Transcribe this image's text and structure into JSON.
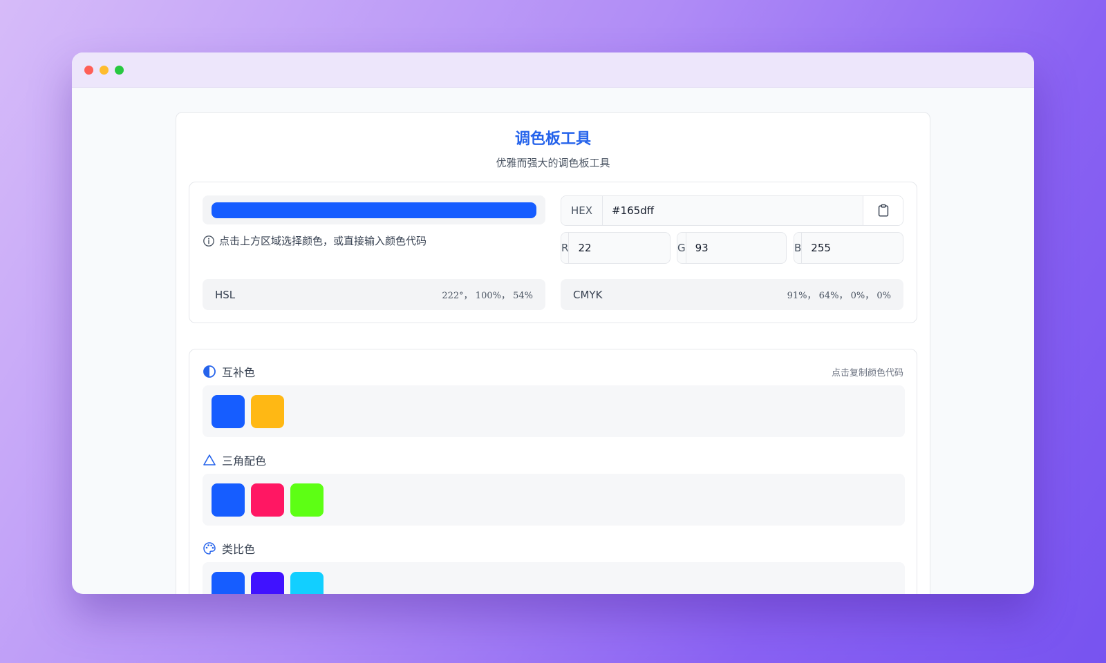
{
  "app": {
    "title": "调色板工具",
    "subtitle": "优雅而强大的调色板工具"
  },
  "picker": {
    "selected_color": "#165dff",
    "hint": "点击上方区域选择颜色，或直接输入颜色代码",
    "hex": {
      "label": "HEX",
      "value": "#165dff",
      "copy_icon": "clipboard-icon"
    },
    "rgb": [
      {
        "label": "R",
        "value": "22"
      },
      {
        "label": "G",
        "value": "93"
      },
      {
        "label": "B",
        "value": "255"
      }
    ],
    "hsl": {
      "label": "HSL",
      "value": "222°， 100%， 54%"
    },
    "cmyk": {
      "label": "CMYK",
      "value": "91%， 64%， 0%， 0%"
    }
  },
  "schemes": {
    "copy_hint": "点击复制颜色代码",
    "groups": [
      {
        "name": "互补色",
        "icon": "contrast-icon",
        "colors": [
          "#165dff",
          "#ffb814"
        ]
      },
      {
        "name": "三角配色",
        "icon": "triangle-icon",
        "colors": [
          "#165dff",
          "#ff1763",
          "#5dff14"
        ]
      },
      {
        "name": "类比色",
        "icon": "palette-icon",
        "colors": [
          "#165dff",
          "#4012ff",
          "#12cfff"
        ]
      }
    ]
  },
  "colors": {
    "accent": "#2563eb",
    "window_red": "#fe5f57",
    "window_yellow": "#febc2e",
    "window_green": "#28c840"
  }
}
